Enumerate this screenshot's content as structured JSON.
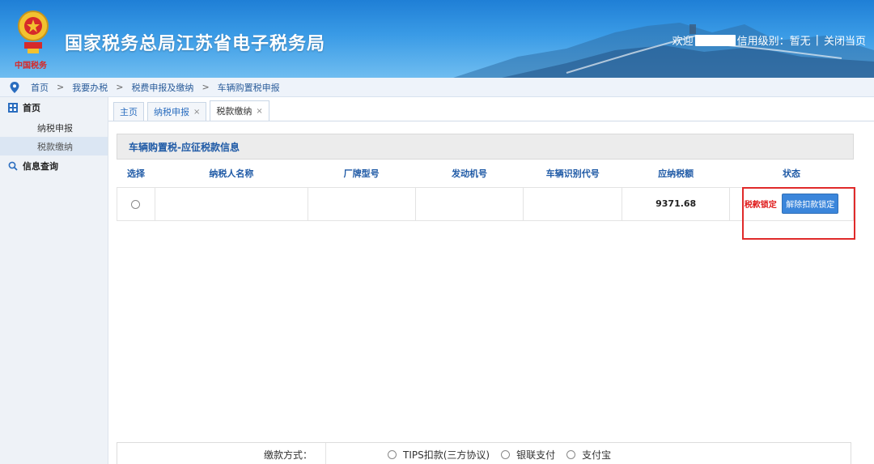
{
  "header": {
    "site_title": "国家税务总局江苏省电子税务局",
    "emblem_caption": "中国税务",
    "welcome": "欢迎",
    "credit_level": "信用级别：暂无",
    "close_page": "关闭当页"
  },
  "breadcrumb": [
    "首页",
    "我要办税",
    "税费申报及缴纳",
    "车辆购置税申报"
  ],
  "sidebar": {
    "groups": [
      {
        "label": "首页",
        "items": [
          "纳税申报",
          "税款缴纳"
        ]
      },
      {
        "label": "信息查询",
        "items": []
      }
    ],
    "active_item": "税款缴纳"
  },
  "tabs": [
    {
      "label": "主页",
      "closable": false
    },
    {
      "label": "纳税申报",
      "closable": true
    },
    {
      "label": "税款缴纳",
      "closable": true
    }
  ],
  "panel": {
    "title": "车辆购置税-应征税款信息",
    "columns": [
      "选择",
      "纳税人名称",
      "厂牌型号",
      "发动机号",
      "车辆识别代号",
      "应纳税额",
      "状态"
    ],
    "rows": [
      {
        "taxpayer": "",
        "model": "",
        "engine": "",
        "vin": "",
        "amount": "9371.68",
        "status": "税款锁定",
        "action": "解除扣款锁定"
      }
    ]
  },
  "payment": {
    "label": "缴款方式：",
    "options": [
      "TIPS扣款(三方协议)",
      "银联支付",
      "支付宝"
    ]
  },
  "colors": {
    "accent": "#1f5aa6",
    "alert": "#e02020",
    "button": "#3b86db"
  },
  "icons": [
    "emblem-icon",
    "location-pin-icon",
    "home-grid-icon",
    "search-icon"
  ]
}
